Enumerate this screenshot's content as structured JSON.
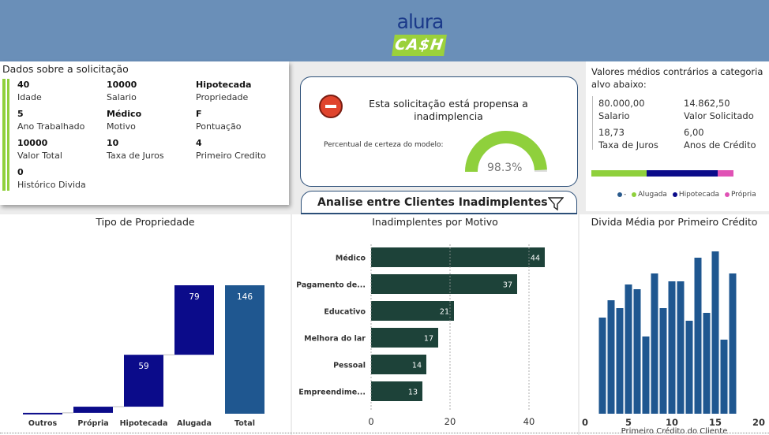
{
  "header": {
    "logo_top": "alura",
    "logo_bottom": "CA$H"
  },
  "info": {
    "title": "Dados sobre a solicitação",
    "items": [
      {
        "value": "40",
        "label": "Idade"
      },
      {
        "value": "10000",
        "label": "Salario"
      },
      {
        "value": "Hipotecada",
        "label": "Propriedade"
      },
      {
        "value": "5",
        "label": "Ano Trabalhado"
      },
      {
        "value": "Médico",
        "label": "Motivo"
      },
      {
        "value": "F",
        "label": "Pontuação"
      },
      {
        "value": "10000",
        "label": "Valor Total"
      },
      {
        "value": "10",
        "label": "Taxa de Juros"
      },
      {
        "value": "4",
        "label": "Primeiro Credito"
      },
      {
        "value": "0",
        "label": "Histórico Divida"
      }
    ]
  },
  "risk": {
    "icon": "stop-icon",
    "message": "Esta solicitação está propensa a inadimplencia",
    "certainty_label": "Percentual de certeza do modelo:",
    "certainty_value": "98.3%",
    "certainty_fraction": 0.983,
    "gauge_color": "#8fd03c"
  },
  "means": {
    "title": "Valores médios contrários a categoria alvo abaixo:",
    "items": [
      {
        "value": "80.000,00",
        "label": "Salario"
      },
      {
        "value": "14.862,50",
        "label": "Valor Solicitado"
      },
      {
        "value": "18,73",
        "label": "Taxa de Juros"
      },
      {
        "value": "6,00",
        "label": "Anos de Crédito"
      }
    ],
    "legend": [
      {
        "name": "-",
        "color": "#2a5a8c"
      },
      {
        "name": "Alugada",
        "color": "#8fd03c"
      },
      {
        "name": "Hipotecada",
        "color": "#0b0b8a"
      },
      {
        "name": "Própria",
        "color": "#e052b5"
      }
    ],
    "stack_shares": [
      0.0,
      0.39,
      0.5,
      0.11
    ]
  },
  "tab": {
    "label": "Analise entre Clientes Inadimplentes",
    "icon": "filter-icon"
  },
  "chart_data": [
    {
      "type": "bar",
      "subtype": "waterfall",
      "title": "Tipo de Propriedade",
      "categories": [
        "Outros",
        "Própria",
        "Hipotecada",
        "Alugada",
        "Total"
      ],
      "values": [
        1,
        7,
        59,
        79,
        146
      ],
      "labels": [
        "",
        "",
        "59",
        "79",
        "146"
      ],
      "colors": {
        "step": "#0b0b8a",
        "total": "#1f5790"
      },
      "ylim": [
        0,
        146
      ]
    },
    {
      "type": "bar",
      "orientation": "horizontal",
      "title": "Inadimplentes por Motivo",
      "categories": [
        "Médico",
        "Pagamento de...",
        "Educativo",
        "Melhora do lar",
        "Pessoal",
        "Empreendime..."
      ],
      "values": [
        44,
        37,
        21,
        17,
        14,
        13
      ],
      "xticks": [
        "0",
        "20",
        "40"
      ],
      "xlim": [
        0,
        50
      ],
      "color": "#1d4239"
    },
    {
      "type": "bar",
      "title": "Divida Média por Primeiro Crédito",
      "xlabel": "Primeiro Crédito do Cliente",
      "x": [
        2,
        3,
        4,
        5,
        6,
        7,
        8,
        9,
        10,
        11,
        12,
        13,
        14,
        15,
        16,
        17
      ],
      "values": [
        0.61,
        0.72,
        0.67,
        0.82,
        0.79,
        0.49,
        0.89,
        0.67,
        0.84,
        0.84,
        0.59,
        0.99,
        0.64,
        1.03,
        0.47,
        0.89
      ],
      "xticks": [
        "0",
        "5",
        "10",
        "15",
        "20"
      ],
      "xlim": [
        0,
        20
      ],
      "color": "#1f5790"
    }
  ]
}
